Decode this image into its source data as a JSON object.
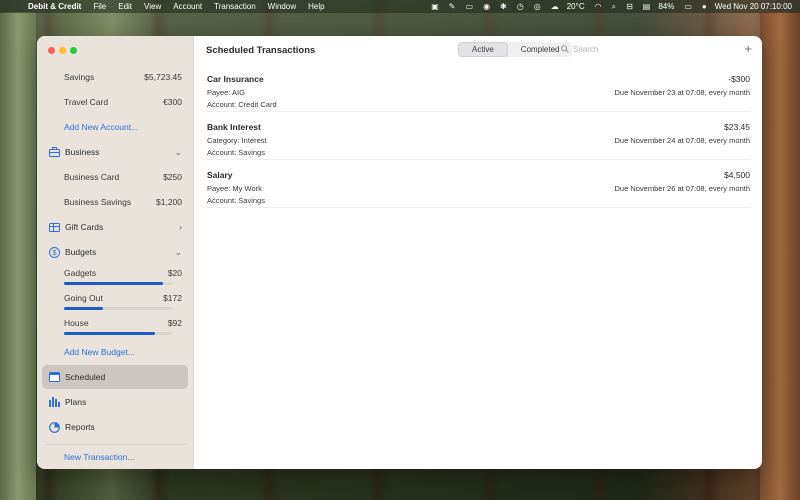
{
  "menubar": {
    "app_name": "Debit & Credit",
    "items": [
      "File",
      "Edit",
      "View",
      "Account",
      "Transaction",
      "Window",
      "Help"
    ],
    "weather": "20°C",
    "battery": "84%",
    "datetime": "Wed Nov 20  07:10:00"
  },
  "sidebar": {
    "accounts": [
      {
        "label": "Savings",
        "value": "$5,723.45"
      },
      {
        "label": "Travel Card",
        "value": "€300"
      }
    ],
    "add_account": "Add New Account...",
    "business": {
      "label": "Business",
      "items": [
        {
          "label": "Business Card",
          "value": "$250"
        },
        {
          "label": "Business Savings",
          "value": "$1,200"
        }
      ]
    },
    "gift_cards": "Gift Cards",
    "budgets": {
      "label": "Budgets",
      "items": [
        {
          "label": "Gadgets",
          "value": "$20",
          "progress": 0.92
        },
        {
          "label": "Going Out",
          "value": "$172",
          "progress": 0.36
        },
        {
          "label": "House",
          "value": "$92",
          "progress": 0.84
        }
      ]
    },
    "add_budget": "Add New Budget...",
    "nav": [
      {
        "label": "Scheduled"
      },
      {
        "label": "Plans"
      },
      {
        "label": "Reports"
      }
    ],
    "new_transaction": "New Transaction..."
  },
  "main": {
    "title": "Scheduled Transactions",
    "tabs": [
      {
        "label": "Active",
        "selected": true
      },
      {
        "label": "Completed",
        "selected": false
      }
    ],
    "search_placeholder": "Search",
    "add_label": "+",
    "transactions": [
      {
        "name": "Car Insurance",
        "amount": "-$300",
        "line1": "Payee: AIG",
        "line2": "Account: Credit Card",
        "due": "Due November 23 at 07:08, every month"
      },
      {
        "name": "Bank Interest",
        "amount": "$23.45",
        "line1": "Category: Interest",
        "line2": "Account: Savings",
        "due": "Due November 24 at 07:08, every month"
      },
      {
        "name": "Salary",
        "amount": "$4,500",
        "line1": "Payee: My Work",
        "line2": "Account: Savings",
        "due": "Due November 26 at 07:08, every month"
      }
    ]
  },
  "colors": {
    "accent": "#2f6fd6",
    "budget_fill": "#1f5bc4"
  }
}
